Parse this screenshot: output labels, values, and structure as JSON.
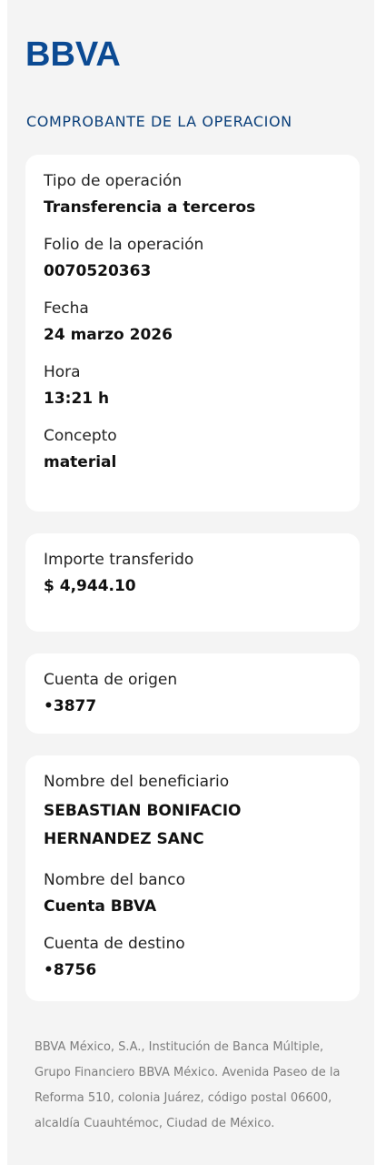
{
  "brand": {
    "logo_text": "BBVA",
    "logo_color": "#0b4a93"
  },
  "section_title": "COMPROBANTE DE LA OPERACION",
  "operation": {
    "type_label": "Tipo de operación",
    "type_value": "Transferencia a terceros",
    "folio_label": "Folio de la operación",
    "folio_value": "0070520363",
    "date_label": "Fecha",
    "date_value": "24 marzo 2026",
    "time_label": "Hora",
    "time_value": "13:21 h",
    "concept_label": "Concepto",
    "concept_value": "material"
  },
  "amount": {
    "label": "Importe transferido",
    "value": "$ 4,944.10"
  },
  "origin": {
    "label": "Cuenta de origen",
    "value": "•3877"
  },
  "beneficiary": {
    "name_label": "Nombre del beneficiario",
    "name_value": "SEBASTIAN BONIFACIO HERNANDEZ SANC",
    "bank_label": "Nombre del banco",
    "bank_value": "Cuenta BBVA",
    "destination_label": "Cuenta de destino",
    "destination_value": "•8756"
  },
  "footer": {
    "text": "BBVA México, S.A., Institución de Banca Múltiple, Grupo Financiero BBVA México. Avenida Paseo de la Reforma 510, colonia Juárez, código postal 06600, alcaldía Cuauhtémoc, Ciudad de México."
  },
  "colors": {
    "background": "#f4f4f4",
    "card": "#ffffff",
    "title": "#0a3f7a",
    "text": "#1f1f1f",
    "footer": "#7c7c7c"
  }
}
